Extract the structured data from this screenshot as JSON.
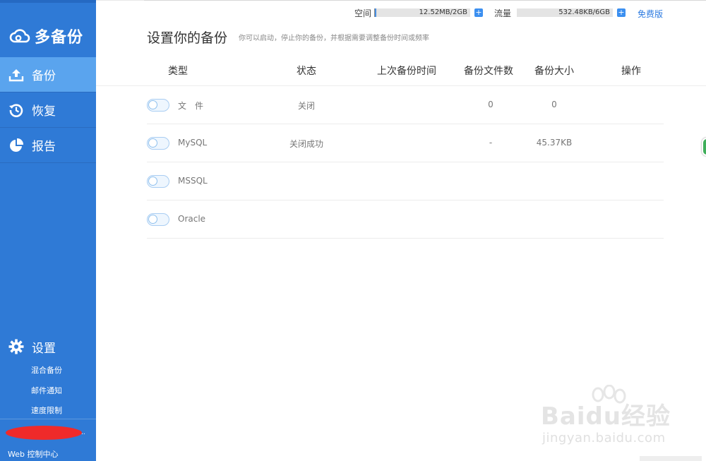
{
  "app": {
    "logo_text": "多备份"
  },
  "sidebar": {
    "items": [
      {
        "label": "备份",
        "icon": "upload-icon",
        "active": true
      },
      {
        "label": "恢复",
        "icon": "history-icon",
        "active": false
      },
      {
        "label": "报告",
        "icon": "pie-chart-icon",
        "active": false
      }
    ],
    "settings": {
      "label": "设置",
      "icon": "gear-icon",
      "sub_items": [
        "混合备份",
        "邮件通知",
        "速度限制"
      ]
    },
    "user_dot": "..",
    "console_link": "Web 控制中心"
  },
  "topbar": {
    "space_label": "空间",
    "space_value": "12.52MB/2GB",
    "traffic_label": "流量",
    "traffic_value": "532.48KB/6GB",
    "plus_glyph": "+",
    "plan_link": "免费版"
  },
  "main": {
    "title": "设置你的备份",
    "subtitle": "你可以启动，停止你的备份，并根据需要调整备份时间或频率",
    "columns": [
      "类型",
      "状态",
      "上次备份时间",
      "备份文件数",
      "备份大小",
      "操作"
    ],
    "rows": [
      {
        "type": "文　件",
        "status": "关闭",
        "last_time": "",
        "file_count": "0",
        "size": "0",
        "enabled": false
      },
      {
        "type": "MySQL",
        "status": "关闭成功",
        "last_time": "",
        "file_count": "-",
        "size": "45.37KB",
        "enabled": false
      },
      {
        "type": "MSSQL",
        "status": "",
        "last_time": "",
        "file_count": "",
        "size": "",
        "enabled": false
      },
      {
        "type": "Oracle",
        "status": "",
        "last_time": "",
        "file_count": "",
        "size": "",
        "enabled": false
      }
    ]
  },
  "watermark": {
    "brand": "Baidu经验",
    "url": "jingyan.baidu.com"
  },
  "colors": {
    "sidebar": "#2f7ad6",
    "sidebar_active": "#5aa4ee",
    "accent": "#2d7be0",
    "toggle_border": "#a9cdf2"
  }
}
